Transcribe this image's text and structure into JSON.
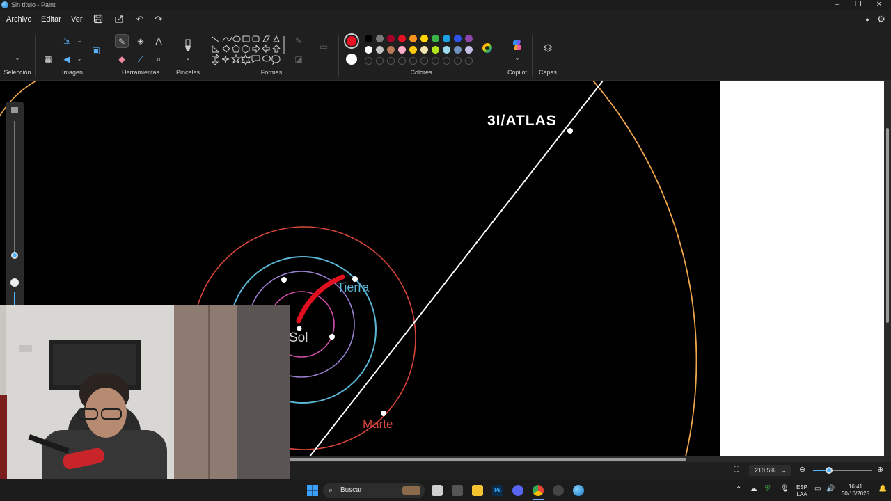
{
  "window": {
    "title": "Sin título - Paint"
  },
  "menu": {
    "archivo": "Archivo",
    "editar": "Editar",
    "ver": "Ver"
  },
  "ribbon": {
    "groups": {
      "seleccion": "Selección",
      "imagen": "Imagen",
      "herramientas": "Herramientas",
      "pinceles": "Pinceles",
      "formas": "Formas",
      "colores": "Colores",
      "copilot": "Copilot",
      "capas": "Capas"
    },
    "active_color": "#e81123",
    "secondary_color": "#ffffff",
    "palette_row1": [
      "#000000",
      "#7a7a7a",
      "#a4002a",
      "#e81123",
      "#f7931e",
      "#ffd400",
      "#3bb54a",
      "#1ba1e2",
      "#2f54eb",
      "#8e44ad"
    ],
    "palette_row2": [
      "#ffffff",
      "#c3c3c3",
      "#b97a57",
      "#ffaec9",
      "#ffc90e",
      "#efe4b0",
      "#b5e61d",
      "#99d9ea",
      "#7092be",
      "#c8bfe7"
    ]
  },
  "canvas": {
    "labels": {
      "atlas": "3I/ATLAS",
      "tierra": "Tierra",
      "sol": "Sol",
      "marte": "Marte"
    },
    "colors": {
      "mars_orbit": "#d9463b",
      "earth_orbit": "#5bb6d6",
      "venus_orbit": "#9a7fd0",
      "mercury_orbit": "#d04fa8",
      "outer_orbit": "#f0a64c",
      "trajectory": "#ffffff",
      "annotation": "#e0101f"
    }
  },
  "status": {
    "zoom": "210.5%"
  },
  "taskbar": {
    "search_placeholder": "Buscar",
    "lang_line1": "ESP",
    "lang_line2": "LAA",
    "time": "16:41",
    "date": "30/10/2025"
  }
}
